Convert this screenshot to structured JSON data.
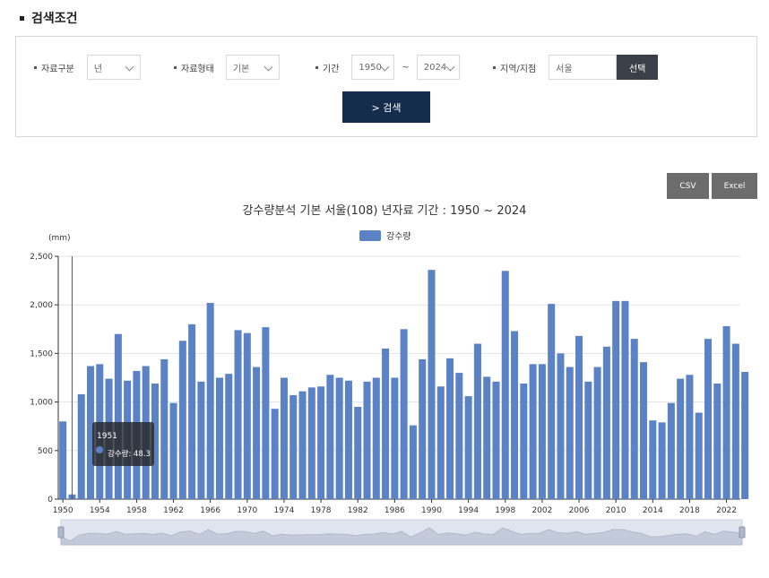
{
  "search": {
    "title": "검색조건",
    "data_type_label": "자료구분",
    "data_type_value": "년",
    "form_label": "자료형태",
    "form_value": "기본",
    "period_label": "기간",
    "period_from": "1950",
    "period_sep": "~",
    "period_to": "2024",
    "region_label": "지역/지점",
    "region_value": "서울",
    "pick_label": "선택",
    "search_label": "> 검색"
  },
  "downloads": {
    "csv": "CSV",
    "excel": "Excel"
  },
  "colors": {
    "bar": "#5b82c5",
    "search_button": "#142d4c",
    "pick_button": "#3b3f47"
  },
  "chart_data": {
    "type": "bar",
    "title": "강수량분석 기본 서울(108) 년자료 기간 : 1950 ~ 2024",
    "ylabel": "(mm)",
    "xlabel": "",
    "ylim": [
      0,
      2500
    ],
    "yticks": [
      0,
      500,
      1000,
      1500,
      2000,
      2500
    ],
    "ytick_labels": [
      "0",
      "500",
      "1,000",
      "1,500",
      "2,000",
      "2,500"
    ],
    "xtick_labels": [
      "1950",
      "1954",
      "1958",
      "1962",
      "1966",
      "1970",
      "1974",
      "1978",
      "1982",
      "1986",
      "1990",
      "1994",
      "1998",
      "2002",
      "2006",
      "2010",
      "2014",
      "2018",
      "2022"
    ],
    "grid": true,
    "legend_position": "top-center",
    "categories": [
      1950,
      1951,
      1952,
      1953,
      1954,
      1955,
      1956,
      1957,
      1958,
      1959,
      1960,
      1961,
      1962,
      1963,
      1964,
      1965,
      1966,
      1967,
      1968,
      1969,
      1970,
      1971,
      1972,
      1973,
      1974,
      1975,
      1976,
      1977,
      1978,
      1979,
      1980,
      1981,
      1982,
      1983,
      1984,
      1985,
      1986,
      1987,
      1988,
      1989,
      1990,
      1991,
      1992,
      1993,
      1994,
      1995,
      1996,
      1997,
      1998,
      1999,
      2000,
      2001,
      2002,
      2003,
      2004,
      2005,
      2006,
      2007,
      2008,
      2009,
      2010,
      2011,
      2012,
      2013,
      2014,
      2015,
      2016,
      2017,
      2018,
      2019,
      2020,
      2021,
      2022,
      2023
    ],
    "series": [
      {
        "name": "강수량",
        "values": [
          800,
          48.3,
          1080,
          1370,
          1390,
          1240,
          1700,
          1220,
          1320,
          1370,
          1190,
          1440,
          990,
          1630,
          1800,
          1210,
          2020,
          1250,
          1290,
          1740,
          1710,
          1360,
          1770,
          930,
          1250,
          1070,
          1110,
          1150,
          1160,
          1280,
          1250,
          1220,
          950,
          1210,
          1250,
          1550,
          1250,
          1750,
          760,
          1440,
          2360,
          1160,
          1450,
          1300,
          1060,
          1600,
          1260,
          1210,
          2350,
          1730,
          1190,
          1390,
          1390,
          2010,
          1500,
          1360,
          1680,
          1210,
          1360,
          1570,
          2040,
          2040,
          1650,
          1410,
          810,
          790,
          990,
          1240,
          1280,
          890,
          1650,
          1190,
          1780,
          1600,
          1310
        ]
      }
    ],
    "tooltip": {
      "year": "1951",
      "text": "강수량: 48.3"
    }
  }
}
